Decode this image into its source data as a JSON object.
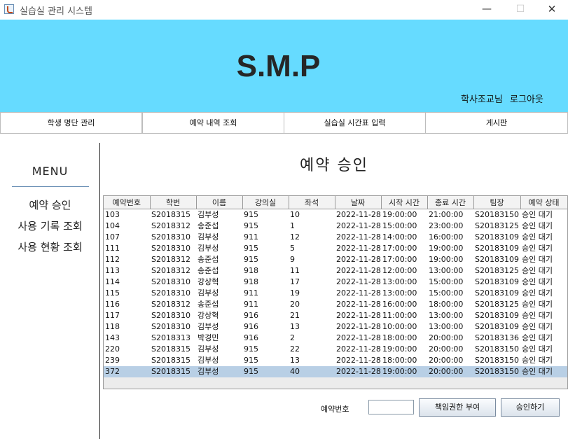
{
  "window": {
    "title": "실습실 관리 시스템",
    "minimize": "—",
    "maximize": "☐",
    "close": "✕"
  },
  "header": {
    "logo": "S.M.P",
    "user": "학사조교님",
    "logout": "로그아웃"
  },
  "nav": [
    {
      "label": "학생 명단 관리"
    },
    {
      "label": "예약 내역 조회"
    },
    {
      "label": "실습실 시간표 입력"
    },
    {
      "label": "게시판"
    }
  ],
  "sidebar": {
    "title": "MENU",
    "items": [
      {
        "label": "예약 승인"
      },
      {
        "label": "사용 기록 조회"
      },
      {
        "label": "사용 현황 조회"
      }
    ]
  },
  "main": {
    "title": "예약 승인"
  },
  "table": {
    "columns": [
      "예약번호",
      "학번",
      "이름",
      "강의실",
      "좌석",
      "날짜",
      "시작 시간",
      "종료 시간",
      "팀장",
      "예약 상태"
    ],
    "rows": [
      [
        "103",
        "S2018315",
        "김부성",
        "915",
        "10",
        "2022-11-28",
        "19:00:00",
        "21:00:00",
        "S20183150",
        "승인 대기"
      ],
      [
        "104",
        "S2018312",
        "송준섭",
        "915",
        "1",
        "2022-11-28",
        "15:00:00",
        "23:00:00",
        "S20183125",
        "승인 대기"
      ],
      [
        "107",
        "S2018310",
        "김부성",
        "911",
        "12",
        "2022-11-28",
        "14:00:00",
        "16:00:00",
        "S20183109",
        "승인 대기"
      ],
      [
        "111",
        "S2018310",
        "김부성",
        "915",
        "5",
        "2022-11-28",
        "17:00:00",
        "19:00:00",
        "S20183109",
        "승인 대기"
      ],
      [
        "112",
        "S2018312",
        "송준섭",
        "915",
        "9",
        "2022-11-28",
        "17:00:00",
        "19:00:00",
        "S20183109",
        "승인 대기"
      ],
      [
        "113",
        "S2018312",
        "송준섭",
        "918",
        "11",
        "2022-11-28",
        "12:00:00",
        "13:00:00",
        "S20183125",
        "승인 대기"
      ],
      [
        "114",
        "S2018310",
        "강상혁",
        "918",
        "17",
        "2022-11-28",
        "13:00:00",
        "15:00:00",
        "S20183109",
        "승인 대기"
      ],
      [
        "115",
        "S2018310",
        "김부성",
        "911",
        "19",
        "2022-11-28",
        "13:00:00",
        "15:00:00",
        "S20183109",
        "승인 대기"
      ],
      [
        "116",
        "S2018312",
        "송준섭",
        "911",
        "20",
        "2022-11-28",
        "16:00:00",
        "18:00:00",
        "S20183125",
        "승인 대기"
      ],
      [
        "117",
        "S2018310",
        "강상혁",
        "916",
        "21",
        "2022-11-28",
        "11:00:00",
        "13:00:00",
        "S20183109",
        "승인 대기"
      ],
      [
        "118",
        "S2018310",
        "김부성",
        "916",
        "13",
        "2022-11-28",
        "10:00:00",
        "13:00:00",
        "S20183109",
        "승인 대기"
      ],
      [
        "143",
        "S2018313",
        "박경민",
        "916",
        "2",
        "2022-11-28",
        "18:00:00",
        "20:00:00",
        "S20183136",
        "승인 대기"
      ],
      [
        "220",
        "S2018315",
        "김부성",
        "915",
        "22",
        "2022-11-28",
        "19:00:00",
        "20:00:00",
        "S20183150",
        "승인 대기"
      ],
      [
        "239",
        "S2018315",
        "김부성",
        "915",
        "13",
        "2022-11-28",
        "18:00:00",
        "20:00:00",
        "S20183150",
        "승인 대기"
      ],
      [
        "372",
        "S2018315",
        "김부성",
        "915",
        "40",
        "2022-11-28",
        "19:00:00",
        "20:00:00",
        "S20183150",
        "승인 대기"
      ]
    ],
    "selected_index": 14
  },
  "footer": {
    "reservation_label": "예약번호",
    "reservation_value": "",
    "grant_button": "책임권한 부여",
    "approve_button": "승인하기"
  }
}
